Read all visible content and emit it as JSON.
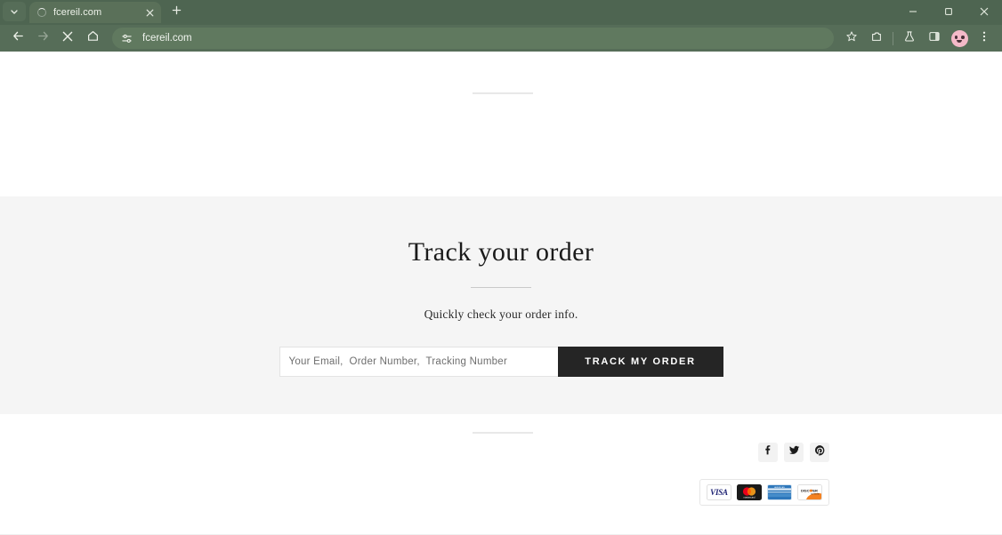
{
  "browser": {
    "tab": {
      "title": "fcereil.com",
      "favicon": "loading-spinner-icon",
      "close_icon": "close-icon"
    },
    "tab_list_icon": "chevron-down-icon",
    "new_tab_icon": "plus-icon",
    "window_controls": {
      "minimize": "minimize-icon",
      "maximize": "maximize-icon",
      "close": "close-icon"
    },
    "toolbar": {
      "back_icon": "back-arrow-icon",
      "forward_icon": "forward-arrow-icon",
      "stop_icon": "stop-loading-icon",
      "home_icon": "home-icon",
      "omnibox": {
        "site_settings_icon": "tune-sliders-icon",
        "url": "fcereil.com"
      },
      "bookmark_icon": "star-icon",
      "extensions_icon": "extensions-puzzle-icon",
      "labs_icon": "flask-icon",
      "side_panel_icon": "side-panel-icon",
      "profile_icon": "profile-avatar-icon",
      "menu_icon": "three-dot-menu-icon"
    }
  },
  "page": {
    "top_divider": "horizontal-rule",
    "track": {
      "title": "Track your order",
      "title_divider": "horizontal-rule",
      "subtitle": "Quickly check your order info.",
      "input_placeholder": "Your Email,  Order Number,  Tracking Number",
      "input_value": "",
      "button_label": "TRACK MY ORDER"
    },
    "bottom_divider": "horizontal-rule",
    "footer": {
      "social": [
        {
          "name": "facebook",
          "label": "f",
          "icon": "facebook-icon"
        },
        {
          "name": "twitter",
          "label": "",
          "icon": "twitter-icon"
        },
        {
          "name": "pinterest",
          "label": "P",
          "icon": "pinterest-icon"
        }
      ],
      "payments": [
        {
          "name": "visa",
          "label": "VISA"
        },
        {
          "name": "mastercard",
          "label": "mastercard"
        },
        {
          "name": "amex",
          "label": "AMERICAN EXPRESS"
        },
        {
          "name": "discover",
          "label": "DISCOVER"
        }
      ]
    }
  },
  "colors": {
    "chrome_bg": "#4e6551",
    "toolbar_bg": "#566d58",
    "section_bg": "#f5f5f5",
    "button_bg": "#252525",
    "visa_blue": "#1a1f71",
    "amex_blue": "#2e77bb",
    "avatar_pink": "#f4b9c8"
  }
}
